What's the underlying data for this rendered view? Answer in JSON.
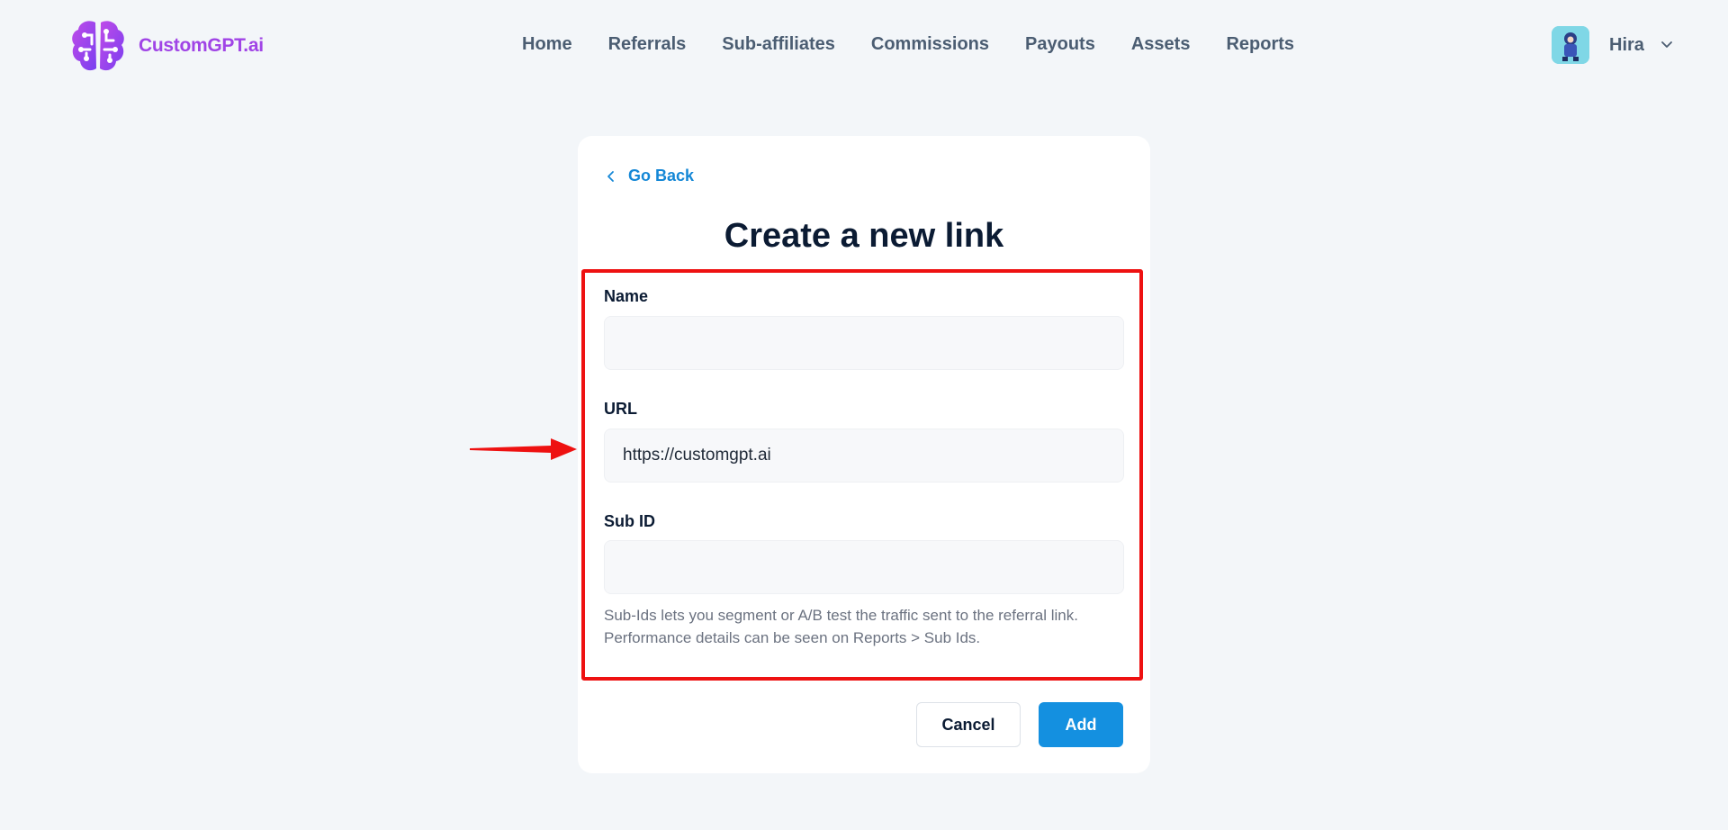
{
  "header": {
    "logo_text": "CustomGPT.ai",
    "nav": [
      {
        "label": "Home"
      },
      {
        "label": "Referrals"
      },
      {
        "label": "Sub-affiliates"
      },
      {
        "label": "Commissions"
      },
      {
        "label": "Payouts"
      },
      {
        "label": "Assets"
      },
      {
        "label": "Reports"
      }
    ],
    "user": {
      "name": "Hira"
    }
  },
  "card": {
    "go_back": "Go Back",
    "title": "Create a new link",
    "fields": {
      "name": {
        "label": "Name",
        "value": ""
      },
      "url": {
        "label": "URL",
        "value": "https://customgpt.ai"
      },
      "sub_id": {
        "label": "Sub ID",
        "value": ""
      }
    },
    "help_lines": [
      "Sub-Ids lets you segment or A/B test the traffic sent to the referral link.",
      "Performance details can be seen on Reports > Sub Ids."
    ],
    "buttons": {
      "cancel": "Cancel",
      "add": "Add"
    }
  },
  "colors": {
    "background": "#f3f6f9",
    "link": "#1487d6",
    "primary": "#1490e0",
    "annotation": "#ee1111",
    "brand": "#a044e6"
  },
  "icons": {
    "logo": "brain-circuit-icon",
    "back": "chevron-left-icon",
    "user_menu": "chevron-down-icon",
    "annotation": "red-arrow-icon"
  }
}
